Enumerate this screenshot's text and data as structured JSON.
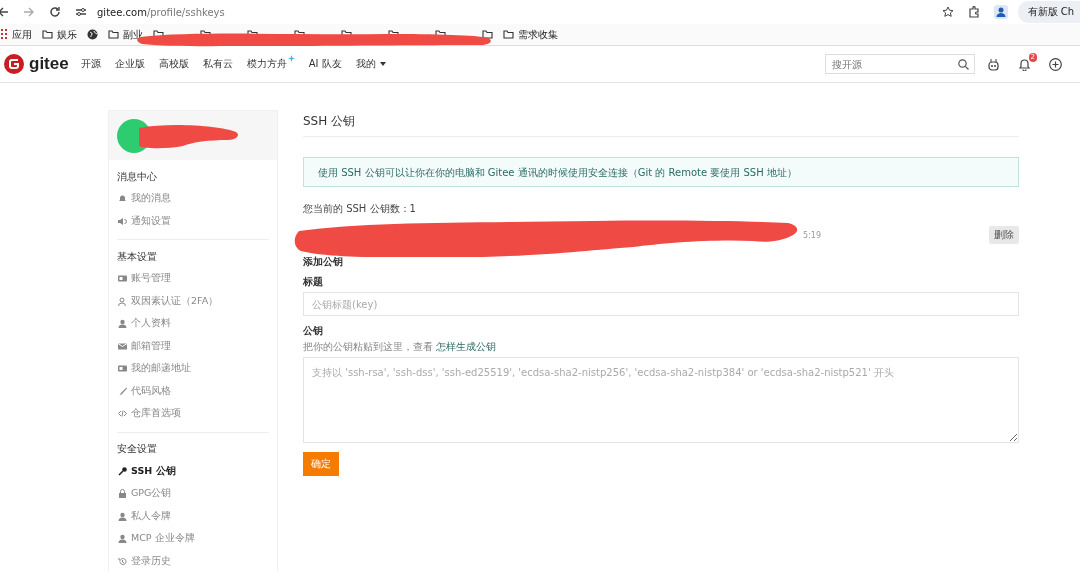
{
  "browser": {
    "url_host": "gitee.com",
    "url_path": "/profile/sshkeys",
    "update_button": "有新版 Ch"
  },
  "bookmarks": [
    {
      "kind": "apps",
      "label": "应用"
    },
    {
      "kind": "folder",
      "label": "娱乐"
    },
    {
      "kind": "globe"
    },
    {
      "kind": "folder",
      "label": "副业"
    },
    {
      "kind": "folder",
      "label": "需求收集"
    }
  ],
  "nav": {
    "logo": "gitee",
    "items": [
      {
        "kind": "link",
        "label": "开源"
      },
      {
        "kind": "link",
        "label": "企业版"
      },
      {
        "kind": "link",
        "label": "高校版"
      },
      {
        "kind": "link",
        "label": "私有云"
      },
      {
        "kind": "sparkle",
        "label": "模力方舟"
      },
      {
        "kind": "link",
        "label": "AI 队友"
      },
      {
        "kind": "dropdown",
        "label": "我的"
      }
    ],
    "search_placeholder": "搜开源",
    "notification_count": "2"
  },
  "sidebar": {
    "sections": [
      {
        "title": "消息中心",
        "items": [
          {
            "kind": "bell",
            "label": "我的消息",
            "selected": false
          },
          {
            "kind": "speaker",
            "label": "通知设置",
            "selected": false
          }
        ]
      },
      {
        "title": "基本设置",
        "items": [
          {
            "kind": "card",
            "label": "账号管理",
            "selected": false
          },
          {
            "kind": "person",
            "label": "双因素认证（2FA）",
            "selected": false
          },
          {
            "kind": "user",
            "label": "个人资料",
            "selected": false
          },
          {
            "kind": "mail",
            "label": "邮箱管理",
            "selected": false
          },
          {
            "kind": "card",
            "label": "我的邮递地址",
            "selected": false
          },
          {
            "kind": "brush",
            "label": "代码风格",
            "selected": false
          },
          {
            "kind": "code",
            "label": "仓库首选项",
            "selected": false
          }
        ]
      },
      {
        "title": "安全设置",
        "items": [
          {
            "kind": "key",
            "label": "SSH 公钥",
            "selected": true
          },
          {
            "kind": "lock",
            "label": "GPG公钥",
            "selected": false
          },
          {
            "kind": "user",
            "label": "私人令牌",
            "selected": false
          },
          {
            "kind": "user",
            "label": "MCP 企业令牌",
            "selected": false
          },
          {
            "kind": "history",
            "label": "登录历史",
            "selected": false
          }
        ]
      }
    ]
  },
  "main": {
    "title": "SSH 公钥",
    "info": "使用 SSH 公钥可以让你在你的电脑和 Gitee 通讯的时候使用安全连接（Git 的 Remote 要使用 SSH 地址）",
    "count": "您当前的 SSH 公钥数：1",
    "keys": [
      {
        "time": "5:19",
        "delete_button": "删除"
      }
    ],
    "add_title": "添加公钥",
    "title_label": "标题",
    "title_placeholder": "公钥标题(key)",
    "key_label": "公钥",
    "hint": "把你的公钥粘贴到这里，查看",
    "hint_link": "怎样生成公钥",
    "key_placeholder": "支持以 'ssh-rsa', 'ssh-dss', 'ssh-ed25519', 'ecdsa-sha2-nistp256', 'ecdsa-sha2-nistp384' or 'ecdsa-sha2-nistp521' 开头",
    "submit_button": "确定"
  }
}
